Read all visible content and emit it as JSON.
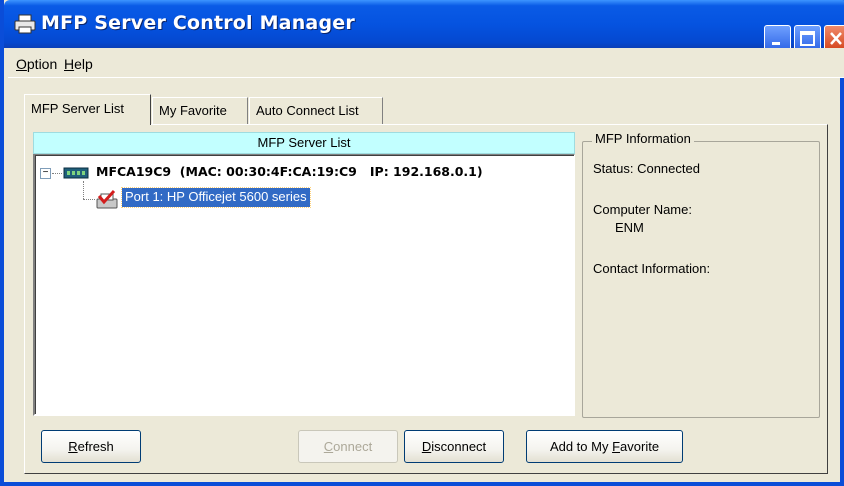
{
  "window": {
    "title": "MFP Server Control Manager",
    "accent": "#0553E0"
  },
  "menu": [
    {
      "mnemonic": "O",
      "rest": "ption"
    },
    {
      "mnemonic": "H",
      "rest": "elp"
    }
  ],
  "tabs": [
    {
      "label": "MFP Server List",
      "active": true
    },
    {
      "label": "My Favorite",
      "active": false
    },
    {
      "label": "Auto Connect List",
      "active": false
    }
  ],
  "server_list": {
    "header": "MFP Server List",
    "header_color": "#C2FFFF",
    "server": {
      "label": "MFCA19C9  (MAC: 00:30:4F:CA:19:C9   IP: 192.168.0.1)",
      "expanded": true
    },
    "port": {
      "label": "Port 1: HP Officejet 5600 series",
      "selected": true
    }
  },
  "info": {
    "legend": "MFP Information",
    "status": "Status: Connected",
    "computer_name_label": "Computer Name:",
    "computer_name_value": "ENM",
    "contact_label": "Contact Information:"
  },
  "buttons": {
    "refresh": {
      "mnemonic": "R",
      "rest": "efresh"
    },
    "connect": {
      "mnemonic": "C",
      "rest": "onnect",
      "disabled": true
    },
    "disconnect": {
      "mnemonic": "D",
      "rest": "isconnect"
    },
    "add_favorite": {
      "prefix": "Add to My ",
      "mnemonic": "F",
      "rest": "avorite"
    }
  }
}
